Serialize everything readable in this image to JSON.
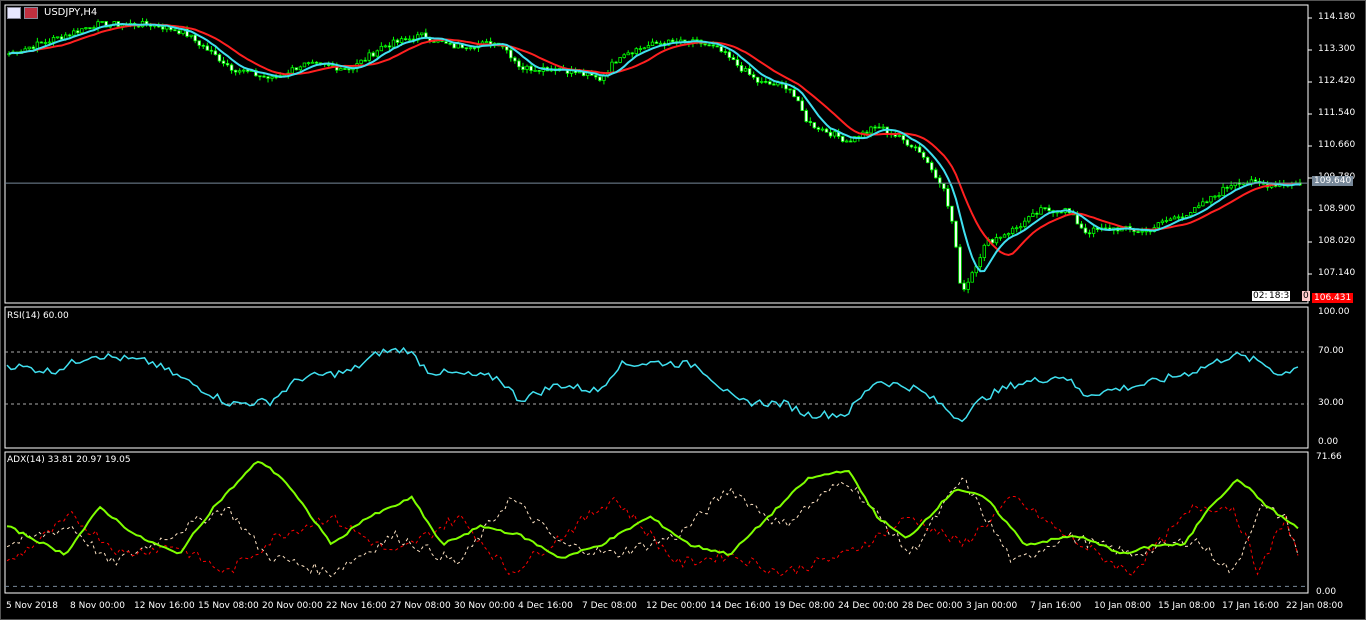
{
  "window": {
    "title": "USDJPY,H4"
  },
  "price_axis": {
    "labels": [
      "114.180",
      "113.300",
      "112.420",
      "111.540",
      "110.660",
      "109.780",
      "108.900",
      "108.020",
      "107.140"
    ],
    "bid_label": "109.640",
    "low_label": "106.431",
    "bid_color": "#778899",
    "low_color": "#ff0000"
  },
  "countdown": {
    "cells": [
      "02:",
      "18:3",
      "0"
    ]
  },
  "rsi": {
    "label": "RSI(14) 60.00",
    "axis": [
      "100.00",
      "70.00",
      "30.00",
      "0.00"
    ],
    "color": "#40e0f0"
  },
  "adx": {
    "label": "ADX(14) 33.81 20.97 19.05",
    "axis_top": "71.66",
    "axis_bottom": "0.00",
    "colors": {
      "adx": "#7fff00",
      "plus_di": "#ffe4c4",
      "minus_di": "#ff0000"
    }
  },
  "time_axis": [
    "5 Nov 2018",
    "8 Nov 00:00",
    "12 Nov 16:00",
    "15 Nov 08:00",
    "20 Nov 00:00",
    "22 Nov 16:00",
    "27 Nov 08:00",
    "30 Nov 00:00",
    "4 Dec 16:00",
    "7 Dec 08:00",
    "12 Dec 00:00",
    "14 Dec 16:00",
    "19 Dec 08:00",
    "24 Dec 00:00",
    "28 Dec 00:00",
    "3 Jan 00:00",
    "7 Jan 16:00",
    "10 Jan 08:00",
    "15 Jan 08:00",
    "17 Jan 16:00",
    "22 Jan 08:00"
  ],
  "chart_data": {
    "type": "line",
    "symbol": "USDJPY",
    "timeframe": "H4",
    "price_waypoints": [
      [
        0,
        113.2
      ],
      [
        0.035,
        113.6
      ],
      [
        0.066,
        114.0
      ],
      [
        0.112,
        114.0
      ],
      [
        0.135,
        113.8
      ],
      [
        0.173,
        112.8
      ],
      [
        0.204,
        112.5
      ],
      [
        0.227,
        112.9
      ],
      [
        0.266,
        112.8
      ],
      [
        0.289,
        113.4
      ],
      [
        0.32,
        113.7
      ],
      [
        0.343,
        113.4
      ],
      [
        0.381,
        113.5
      ],
      [
        0.397,
        112.8
      ],
      [
        0.427,
        112.8
      ],
      [
        0.458,
        112.5
      ],
      [
        0.474,
        113.2
      ],
      [
        0.504,
        113.5
      ],
      [
        0.535,
        113.5
      ],
      [
        0.55,
        113.3
      ],
      [
        0.581,
        112.4
      ],
      [
        0.604,
        112.3
      ],
      [
        0.619,
        111.3
      ],
      [
        0.65,
        110.8
      ],
      [
        0.673,
        111.2
      ],
      [
        0.704,
        110.6
      ],
      [
        0.723,
        109.6
      ],
      [
        0.731,
        108.5
      ],
      [
        0.738,
        106.6
      ],
      [
        0.757,
        108.0
      ],
      [
        0.78,
        108.4
      ],
      [
        0.8,
        108.9
      ],
      [
        0.819,
        108.9
      ],
      [
        0.834,
        108.3
      ],
      [
        0.857,
        108.4
      ],
      [
        0.88,
        108.3
      ],
      [
        0.896,
        108.6
      ],
      [
        0.919,
        108.9
      ],
      [
        0.95,
        109.7
      ],
      [
        0.972,
        109.6
      ],
      [
        1,
        109.64
      ]
    ],
    "rsi_waypoints": [
      [
        0,
        60
      ],
      [
        0.035,
        55
      ],
      [
        0.066,
        68
      ],
      [
        0.112,
        62
      ],
      [
        0.135,
        50
      ],
      [
        0.173,
        30
      ],
      [
        0.204,
        32
      ],
      [
        0.227,
        50
      ],
      [
        0.266,
        55
      ],
      [
        0.289,
        70
      ],
      [
        0.31,
        72
      ],
      [
        0.327,
        55
      ],
      [
        0.381,
        50
      ],
      [
        0.397,
        33
      ],
      [
        0.427,
        45
      ],
      [
        0.458,
        40
      ],
      [
        0.474,
        60
      ],
      [
        0.504,
        62
      ],
      [
        0.535,
        60
      ],
      [
        0.565,
        32
      ],
      [
        0.604,
        30
      ],
      [
        0.619,
        22
      ],
      [
        0.65,
        22
      ],
      [
        0.673,
        48
      ],
      [
        0.704,
        42
      ],
      [
        0.723,
        30
      ],
      [
        0.738,
        18
      ],
      [
        0.757,
        35
      ],
      [
        0.78,
        45
      ],
      [
        0.819,
        52
      ],
      [
        0.834,
        37
      ],
      [
        0.88,
        45
      ],
      [
        0.919,
        55
      ],
      [
        0.95,
        68
      ],
      [
        0.972,
        62
      ],
      [
        0.987,
        52
      ],
      [
        1,
        60
      ]
    ],
    "adx_waypoints": [
      [
        0,
        35
      ],
      [
        0.045,
        20
      ],
      [
        0.072,
        45
      ],
      [
        0.1,
        30
      ],
      [
        0.133,
        20
      ],
      [
        0.16,
        45
      ],
      [
        0.195,
        70
      ],
      [
        0.214,
        60
      ],
      [
        0.252,
        25
      ],
      [
        0.275,
        38
      ],
      [
        0.314,
        50
      ],
      [
        0.337,
        25
      ],
      [
        0.368,
        35
      ],
      [
        0.398,
        30
      ],
      [
        0.429,
        18
      ],
      [
        0.46,
        25
      ],
      [
        0.498,
        40
      ],
      [
        0.529,
        25
      ],
      [
        0.56,
        20
      ],
      [
        0.59,
        40
      ],
      [
        0.62,
        60
      ],
      [
        0.651,
        65
      ],
      [
        0.674,
        40
      ],
      [
        0.697,
        28
      ],
      [
        0.735,
        55
      ],
      [
        0.758,
        50
      ],
      [
        0.789,
        25
      ],
      [
        0.828,
        30
      ],
      [
        0.866,
        20
      ],
      [
        0.889,
        25
      ],
      [
        0.912,
        25
      ],
      [
        0.931,
        45
      ],
      [
        0.954,
        60
      ],
      [
        0.977,
        45
      ],
      [
        1,
        33.81
      ]
    ],
    "plus_di_waypoints": [
      [
        0,
        25
      ],
      [
        0.05,
        35
      ],
      [
        0.08,
        15
      ],
      [
        0.12,
        28
      ],
      [
        0.17,
        45
      ],
      [
        0.2,
        20
      ],
      [
        0.25,
        10
      ],
      [
        0.3,
        30
      ],
      [
        0.35,
        15
      ],
      [
        0.39,
        50
      ],
      [
        0.43,
        25
      ],
      [
        0.47,
        20
      ],
      [
        0.52,
        30
      ],
      [
        0.56,
        55
      ],
      [
        0.6,
        35
      ],
      [
        0.65,
        60
      ],
      [
        0.7,
        20
      ],
      [
        0.74,
        60
      ],
      [
        0.78,
        15
      ],
      [
        0.82,
        30
      ],
      [
        0.87,
        20
      ],
      [
        0.92,
        28
      ],
      [
        0.95,
        10
      ],
      [
        0.97,
        45
      ],
      [
        0.99,
        40
      ],
      [
        1,
        20.97
      ]
    ],
    "minus_di_waypoints": [
      [
        0,
        15
      ],
      [
        0.05,
        40
      ],
      [
        0.09,
        20
      ],
      [
        0.13,
        25
      ],
      [
        0.17,
        10
      ],
      [
        0.21,
        30
      ],
      [
        0.25,
        40
      ],
      [
        0.3,
        20
      ],
      [
        0.35,
        40
      ],
      [
        0.39,
        10
      ],
      [
        0.43,
        30
      ],
      [
        0.47,
        50
      ],
      [
        0.52,
        15
      ],
      [
        0.56,
        20
      ],
      [
        0.6,
        10
      ],
      [
        0.65,
        20
      ],
      [
        0.7,
        40
      ],
      [
        0.74,
        25
      ],
      [
        0.78,
        50
      ],
      [
        0.82,
        30
      ],
      [
        0.87,
        10
      ],
      [
        0.92,
        45
      ],
      [
        0.95,
        45
      ],
      [
        0.97,
        10
      ],
      [
        0.99,
        40
      ],
      [
        1,
        19.05
      ]
    ],
    "rsi_levels": [
      70,
      30
    ],
    "price_range": [
      106.3,
      114.4
    ]
  }
}
